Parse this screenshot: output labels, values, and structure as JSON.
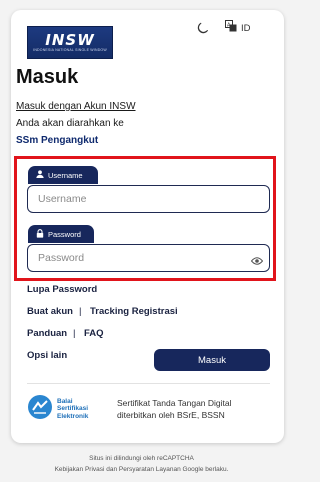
{
  "header": {
    "logo_text": "INSW",
    "logo_subtitle": "INDONESIA NATIONAL SINGLE WINDOW",
    "theme_icon": "moon-icon",
    "lang_icon": "translate-icon",
    "lang_label": "ID"
  },
  "login": {
    "title": "Masuk",
    "insw_link": "Masuk dengan Akun INSW",
    "redirect_text": "Anda akan diarahkan ke",
    "redirect_target": "SSm Pengangkut"
  },
  "form": {
    "username_tab": "Username",
    "username_placeholder": "Username",
    "username_value": "",
    "password_tab": "Password",
    "password_placeholder": "Password",
    "password_value": "",
    "highlight_color": "#e1141b"
  },
  "links": {
    "forgot_password": "Lupa Password",
    "create_account": "Buat akun",
    "tracking": "Tracking Registrasi",
    "guide": "Panduan",
    "faq": "FAQ",
    "other_options": "Opsi lain",
    "separator": "|"
  },
  "submit_label": "Masuk",
  "certificate": {
    "logo_lines": [
      "Balai",
      "Sertifikasi",
      "Elektronik"
    ],
    "text_line1": "Sertifikat Tanda Tangan Digital",
    "text_line2": "diterbitkan oleh BSrE, BSSN"
  },
  "footer": {
    "line1": "Situs ini dilindungi oleh reCAPTCHA",
    "line2": "Kebijakan Privasi dan Persyaratan Layanan Google berlaku."
  },
  "colors": {
    "primary": "#17275c",
    "brand": "#1d3a80",
    "bsre_blue": "#1d6fb8"
  }
}
